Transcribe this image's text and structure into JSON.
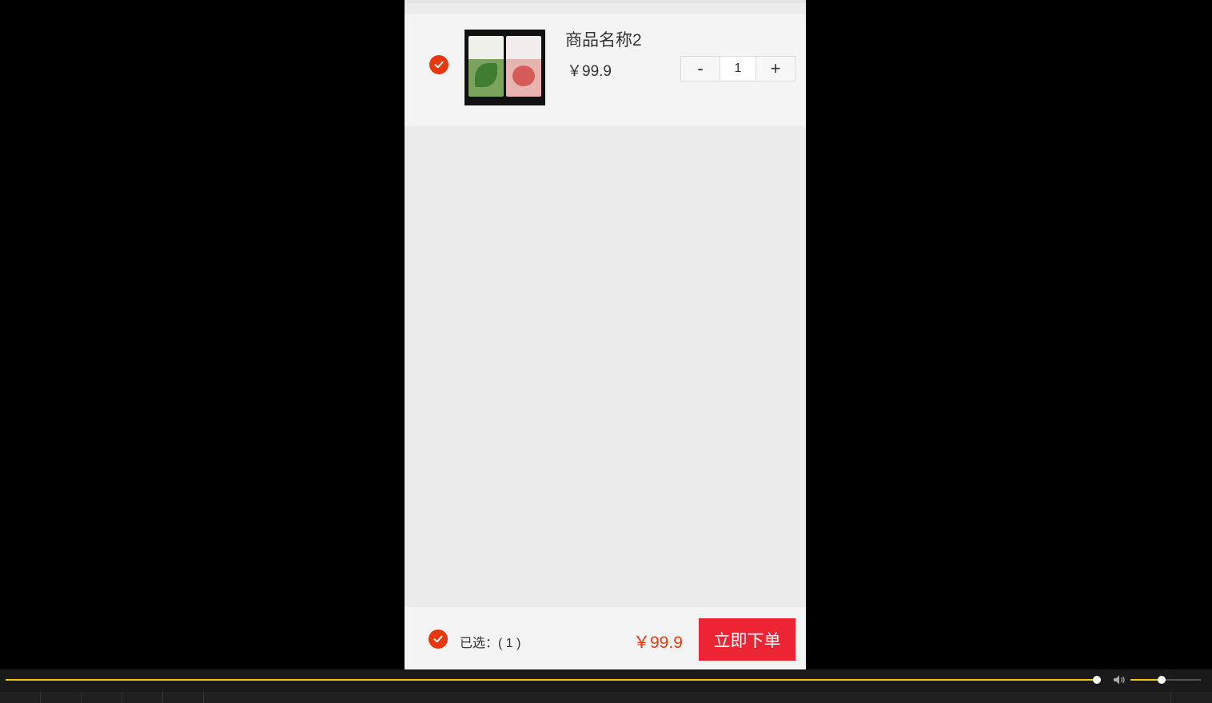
{
  "cart": {
    "items": [
      {
        "name": "商品名称2",
        "price": "￥99.9",
        "quantity": "1",
        "checked": true
      }
    ],
    "stepper": {
      "minus": "-",
      "plus": "+"
    }
  },
  "footer": {
    "selected_label": "已选：( 1 )",
    "total": "￥99.9",
    "order_button": "立即下单"
  },
  "player": {
    "seek_progress": 1.0,
    "volume_level": 0.45
  },
  "colors": {
    "accent": "#e8380d",
    "order_button": "#ec2434",
    "seek": "#f2c811"
  },
  "icons": [
    "check-icon",
    "volume-icon"
  ]
}
